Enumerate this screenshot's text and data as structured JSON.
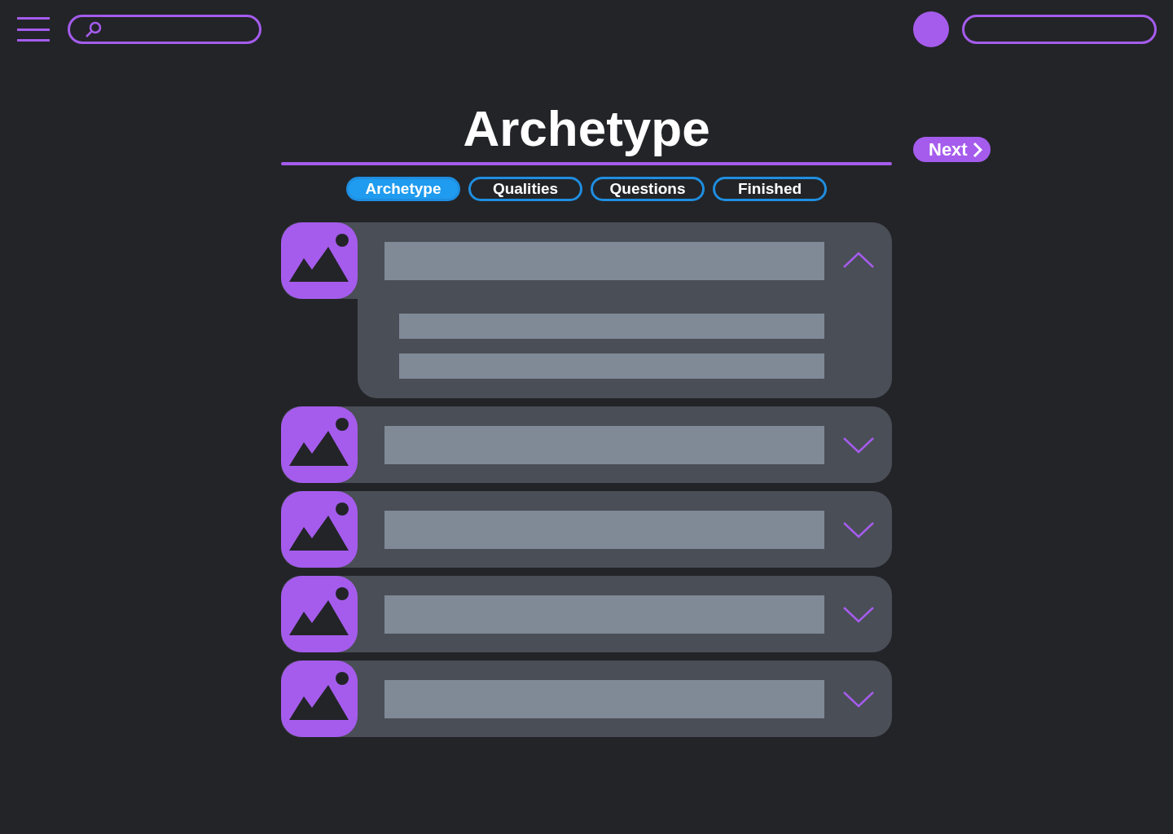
{
  "title": "Archetype",
  "tabs": [
    {
      "label": "Archetype",
      "selected": true
    },
    {
      "label": "Qualities",
      "selected": false
    },
    {
      "label": "Questions",
      "selected": false
    },
    {
      "label": "Finished",
      "selected": false
    }
  ],
  "next_button": "Next",
  "accordion": [
    {
      "expanded": true
    },
    {
      "expanded": false
    },
    {
      "expanded": false
    },
    {
      "expanded": false
    },
    {
      "expanded": false
    }
  ]
}
